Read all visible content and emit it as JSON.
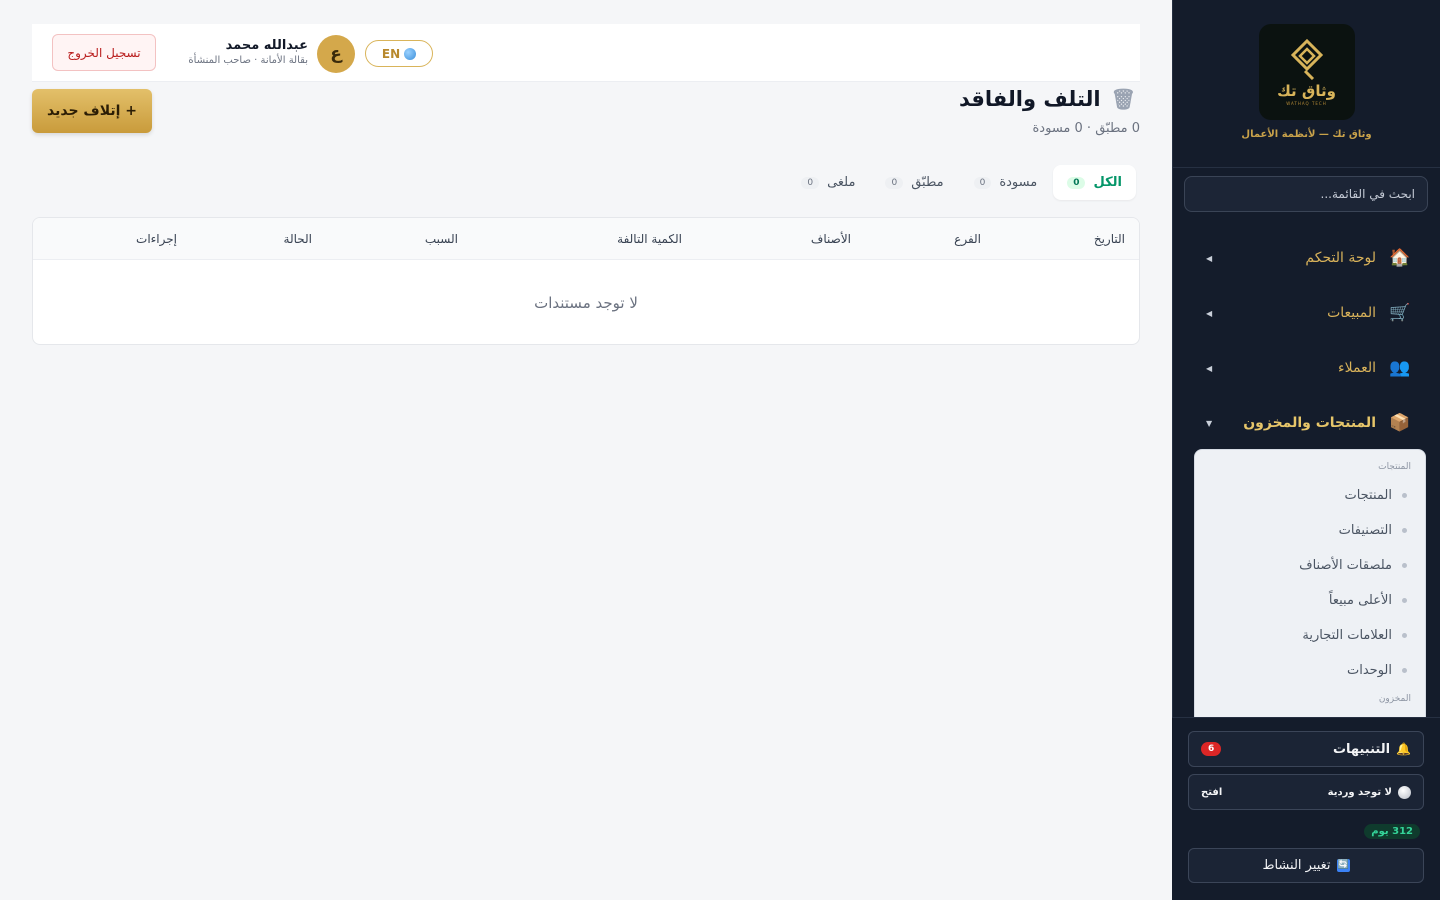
{
  "sidebar": {
    "logo_text": "وثاق تك",
    "logo_sub": "WATHAQ TECH",
    "tagline": "وثاق تك — لأنظمة الأعمال",
    "search_placeholder": "ابحث في القائمة...",
    "nav": [
      {
        "label": "لوحة التحكم",
        "icon": "🏠",
        "arrow": "◀"
      },
      {
        "label": "المبيعات",
        "icon": "🛒",
        "arrow": "◀"
      },
      {
        "label": "العملاء",
        "icon": "👥",
        "arrow": "◀"
      },
      {
        "label": "المنتجات والمخزون",
        "icon": "📦",
        "arrow": "▼"
      }
    ],
    "submenu": {
      "group_products": "المنتجات",
      "items": [
        "المنتجات",
        "التصنيفات",
        "ملصقات الأصناف",
        "الأعلى مبيعاً",
        "العلامات التجارية",
        "الوحدات"
      ],
      "group_inventory": "المخزون"
    },
    "alerts": {
      "label": "التنبيهات",
      "icon": "🔔",
      "count": "6"
    },
    "shift": {
      "label": "لا توجد وردية",
      "action": "افتح"
    },
    "days_badge": "312 يوم",
    "change_activity": {
      "label": "تغيير النشاط",
      "icon": "🔄"
    }
  },
  "topbar": {
    "lang_label": "EN",
    "avatar_letter": "ع",
    "user_name": "عبدالله محمد",
    "user_role": "بقالة الأمانة · صاحب المنشأة",
    "logout_label": "تسجيل الخروج"
  },
  "page": {
    "title": "التلف والفاقد",
    "subtitle": "0 مطبّق · 0 مسودة",
    "new_button": "+ إتلاف جديد"
  },
  "tabs": [
    {
      "label": "الكل",
      "count": "0"
    },
    {
      "label": "مسودة",
      "count": "0"
    },
    {
      "label": "مطبّق",
      "count": "0"
    },
    {
      "label": "ملغى",
      "count": "0"
    }
  ],
  "table": {
    "columns": [
      "التاريخ",
      "الفرع",
      "الأصناف",
      "الكمية التالفة",
      "السبب",
      "الحالة",
      "إجراءات"
    ],
    "empty": "لا توجد مستندات"
  }
}
